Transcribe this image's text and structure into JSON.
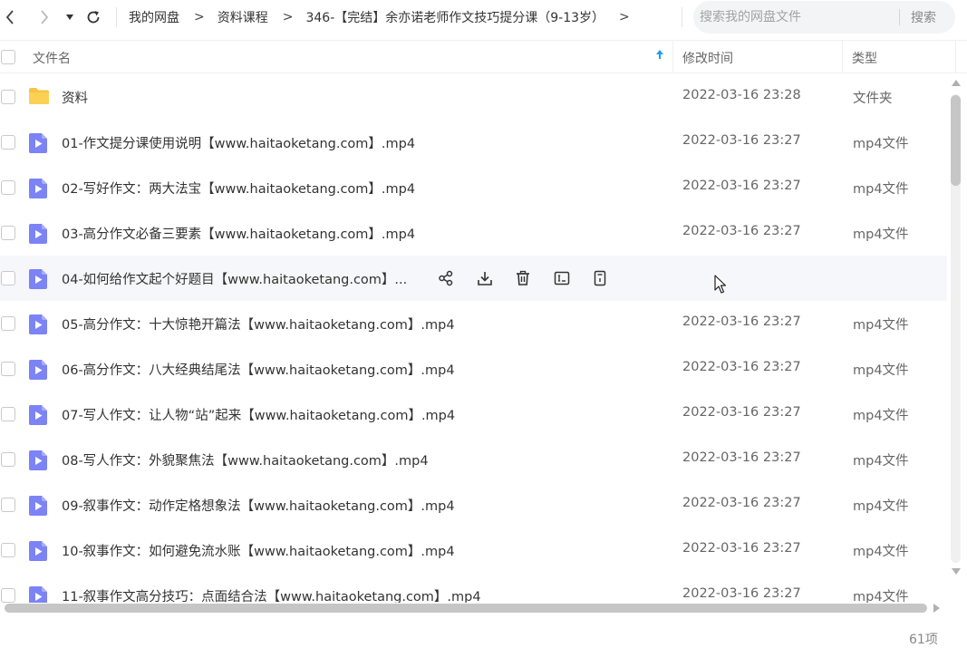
{
  "toolbar": {
    "breadcrumbs": [
      "我的网盘",
      "资料课程",
      "346-【完结】余亦诺老师作文技巧提分课（9-13岁）"
    ],
    "search_placeholder": "搜索我的网盘文件",
    "search_button": "搜索"
  },
  "header": {
    "name": "文件名",
    "time": "修改时间",
    "type": "类型"
  },
  "files": [
    {
      "name": "资料",
      "time": "2022-03-16 23:28",
      "type": "文件夹",
      "icon": "folder-icon"
    },
    {
      "name": "01-作文提分课使用说明【www.haitaoketang.com】.mp4",
      "time": "2022-03-16 23:27",
      "type": "mp4文件",
      "icon": "video-file-icon"
    },
    {
      "name": "02-写好作文：两大法宝【www.haitaoketang.com】.mp4",
      "time": "2022-03-16 23:27",
      "type": "mp4文件",
      "icon": "video-file-icon"
    },
    {
      "name": "03-高分作文必备三要素【www.haitaoketang.com】.mp4",
      "time": "2022-03-16 23:27",
      "type": "mp4文件",
      "icon": "video-file-icon"
    },
    {
      "name": "04-如何给作文起个好题目【www.haitaoketang.com】...",
      "time": "",
      "type": "",
      "icon": "video-file-icon",
      "hover": true
    },
    {
      "name": "05-高分作文：十大惊艳开篇法【www.haitaoketang.com】.mp4",
      "time": "2022-03-16 23:27",
      "type": "mp4文件",
      "icon": "video-file-icon"
    },
    {
      "name": "06-高分作文：八大经典结尾法【www.haitaoketang.com】.mp4",
      "time": "2022-03-16 23:27",
      "type": "mp4文件",
      "icon": "video-file-icon"
    },
    {
      "name": "07-写人作文：让人物“站”起来【www.haitaoketang.com】.mp4",
      "time": "2022-03-16 23:27",
      "type": "mp4文件",
      "icon": "video-file-icon"
    },
    {
      "name": "08-写人作文：外貌聚焦法【www.haitaoketang.com】.mp4",
      "time": "2022-03-16 23:27",
      "type": "mp4文件",
      "icon": "video-file-icon"
    },
    {
      "name": "09-叙事作文：动作定格想象法【www.haitaoketang.com】.mp4",
      "time": "2022-03-16 23:27",
      "type": "mp4文件",
      "icon": "video-file-icon"
    },
    {
      "name": "10-叙事作文：如何避免流水账【www.haitaoketang.com】.mp4",
      "time": "2022-03-16 23:27",
      "type": "mp4文件",
      "icon": "video-file-icon"
    },
    {
      "name": "11-叙事作文高分技巧：点面结合法【www.haitaoketang.com】.mp4",
      "time": "2022-03-16 23:27",
      "type": "mp4文件",
      "icon": "video-file-icon"
    }
  ],
  "row_actions": [
    "share-icon",
    "download-icon",
    "delete-icon",
    "rename-icon",
    "more-icon"
  ],
  "status": {
    "count": "61项"
  },
  "colors": {
    "accent": "#1f9bf0",
    "folder": "#f7c443",
    "video": "#7c83f5"
  }
}
